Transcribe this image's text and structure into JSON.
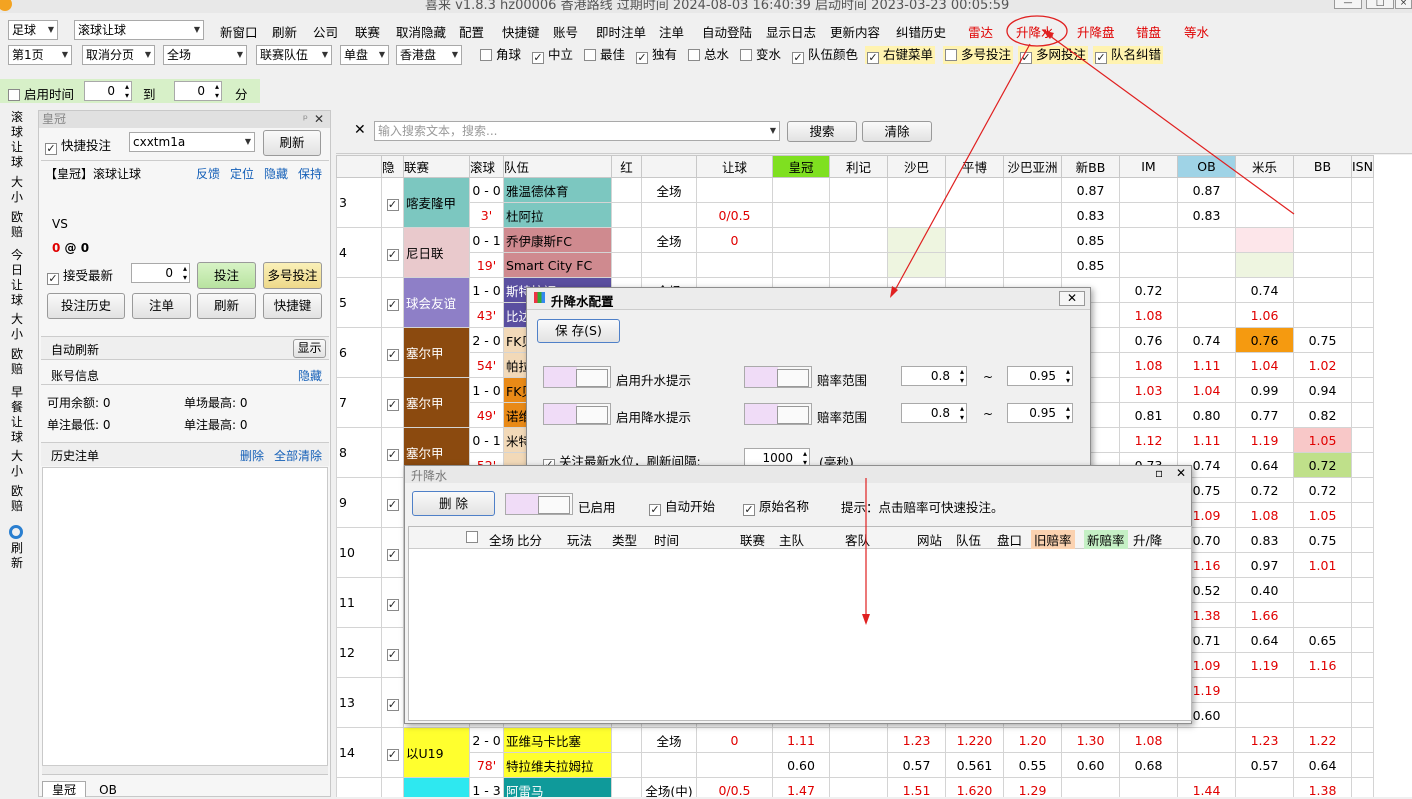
{
  "window": {
    "title": "喜来 v1.8.3 hz00006 香港路线 过期时间 2024-08-03 16:40:39 启动时间 2023-03-23 00:05:59"
  },
  "toolbar": {
    "sport": "足球",
    "mode": "滚球让球",
    "menus": [
      "新窗口",
      "刷新",
      "公司",
      "联赛",
      "取消隐藏",
      "配置",
      "快捷键",
      "账号",
      "即时注单",
      "注单",
      "自动登陆",
      "显示日志",
      "更新内容",
      "纠错历史"
    ],
    "red_menus": [
      "雷达",
      "升降水",
      "升降盘",
      "错盘",
      "等水"
    ]
  },
  "toolbar2": {
    "page": "第1页",
    "paging": "取消分页",
    "scope": "全场",
    "team_filter": "联赛队伍",
    "bet_type": "单盘",
    "odds_type": "香港盘",
    "checks": [
      {
        "label": "角球",
        "checked": false
      },
      {
        "label": "中立",
        "checked": true
      },
      {
        "label": "最佳",
        "checked": false
      },
      {
        "label": "独有",
        "checked": true
      },
      {
        "label": "总水",
        "checked": false
      },
      {
        "label": "变水",
        "checked": false
      },
      {
        "label": "队伍颜色",
        "checked": true
      },
      {
        "label": "右键菜单",
        "checked": true
      },
      {
        "label": "多号投注",
        "checked": false
      },
      {
        "label": "多网投注",
        "checked": true
      },
      {
        "label": "队名纠错",
        "checked": true
      }
    ]
  },
  "timer": {
    "label": "启用时间",
    "from": "0",
    "to_label": "到",
    "to": "0",
    "unit": "分"
  },
  "side_tabs": [
    "滚球让球",
    "大小",
    "欧赔",
    "今日让球",
    "大小",
    "欧赔",
    "早餐让球",
    "大小",
    "欧赔",
    "刷新"
  ],
  "left_panel": {
    "title": "皇冠",
    "quick_bet": "快捷投注",
    "account": "cxxtm1a",
    "refresh": "刷新",
    "game_title": "【皇冠】滚球让球",
    "links": [
      "反馈",
      "定位",
      "隐藏",
      "保持"
    ],
    "vs": "VS",
    "score_a": "0",
    "at": "@",
    "score_b": "0",
    "accept": "接受最新",
    "amount": "0",
    "bet": "投注",
    "multi_bet": "多号投注",
    "history": "投注历史",
    "orders": "注单",
    "refresh2": "刷新",
    "hotkey": "快捷键",
    "auto_refresh": "自动刷新",
    "show": "显示",
    "acct_info": "账号信息",
    "hide": "隐藏",
    "balance_label": "可用余额: 0",
    "max_match": "单场最高: 0",
    "min_bet": "单注最低: 0",
    "max_bet": "单注最高: 0",
    "history_title": "历史注单",
    "delete": "删除",
    "clear_all": "全部清除",
    "bottom_tabs": [
      "皇冠",
      "OB"
    ]
  },
  "search": {
    "placeholder": "输入搜索文本，搜索...",
    "search": "搜索",
    "clear": "清除"
  },
  "grid": {
    "headers": [
      "隐",
      "联赛",
      "滚球",
      "队伍",
      "红",
      "",
      "让球",
      "皇冠",
      "利记",
      "沙巴",
      "平博",
      "沙巴亚洲",
      "新BB",
      "IM",
      "OB",
      "米乐",
      "BB",
      "ISN"
    ],
    "rows": [
      {
        "no": "3",
        "league": "喀麦隆甲",
        "lcolor": "#7cc7c0",
        "score": "0 - 0",
        "time": "3'",
        "home": "雅温德体育",
        "away": "杜阿拉",
        "hcolor": "#7cc7c0",
        "scope": "全场",
        "hdp": [
          "",
          "0/0.5"
        ],
        "hg": [
          "",
          ""
        ],
        "lj": [
          "",
          ""
        ],
        "sb": [
          "",
          ""
        ],
        "pb": [
          "",
          ""
        ],
        "sba": [
          "",
          ""
        ],
        "nbb": [
          "0.87",
          "0.83"
        ],
        "im": [
          "",
          ""
        ],
        "ob": [
          "0.87",
          "0.83"
        ],
        "ml": [
          "",
          ""
        ],
        "bb": [
          "",
          ""
        ],
        "isn": [
          "",
          ""
        ]
      },
      {
        "no": "4",
        "league": "尼日联",
        "lcolor": "#e9c9cc",
        "score": "0 - 1",
        "time": "19'",
        "home": "乔伊康斯FC",
        "away": "Smart City FC",
        "hcolor": "#cf8a8f",
        "scope": "全场",
        "hdp": [
          "0",
          ""
        ],
        "hg": [
          "",
          ""
        ],
        "lj": [
          "",
          ""
        ],
        "sb": [
          "",
          ""
        ],
        "pb": [
          "",
          ""
        ],
        "sba": [
          "",
          ""
        ],
        "nbb": [
          "0.85",
          "0.85"
        ],
        "im": [
          "",
          ""
        ],
        "ob": [
          "",
          ""
        ],
        "ml": [
          "",
          ""
        ],
        "bb": [
          "",
          ""
        ],
        "isn": [
          "",
          ""
        ]
      },
      {
        "no": "5",
        "league": "球会友谊",
        "lcolor": "#8e7fc7",
        "score": "1 - 0",
        "time": "43'",
        "home": "斯特拉福",
        "away": "比达",
        "hcolor": "#5a4fa0",
        "scope": "全场",
        "hdp": [
          "",
          ""
        ],
        "hg": [
          "",
          ""
        ],
        "lj": [
          "",
          ""
        ],
        "sb": [
          "",
          ""
        ],
        "pb": [
          "",
          ""
        ],
        "sba": [
          "",
          ""
        ],
        "nbb": [
          "",
          ""
        ],
        "im": [
          "0.72",
          "1.08"
        ],
        "ob": [
          "",
          ""
        ],
        "ml": [
          "0.74",
          "1.06"
        ],
        "bb": [
          "",
          ""
        ],
        "isn": [
          "",
          ""
        ]
      },
      {
        "no": "6",
        "league": "塞尔甲",
        "lcolor": "#8b4a0f",
        "score": "2 - 0",
        "time": "54'",
        "home": "FK贝",
        "away": "帕拉",
        "hcolor": "#f2d9b8",
        "scope": "",
        "hdp": [
          "",
          ""
        ],
        "hg": [
          "",
          ""
        ],
        "lj": [
          "",
          ""
        ],
        "sb": [
          "",
          ""
        ],
        "pb": [
          "",
          ""
        ],
        "sba": [
          "",
          ""
        ],
        "nbb": [
          "",
          ""
        ],
        "im": [
          "0.76",
          "1.08"
        ],
        "ob": [
          "0.74",
          "1.11"
        ],
        "ml": [
          "0.76",
          "1.04"
        ],
        "bb": [
          "0.75",
          "1.02"
        ],
        "isn": [
          "",
          ""
        ]
      },
      {
        "no": "7",
        "league": "塞尔甲",
        "lcolor": "#8b4a0f",
        "score": "1 - 0",
        "time": "49'",
        "home": "FK贝",
        "away": "诺维",
        "hcolor": "#e98a17",
        "scope": "",
        "hdp": [
          "",
          ""
        ],
        "hg": [
          "",
          ""
        ],
        "lj": [
          "",
          ""
        ],
        "sb": [
          "",
          ""
        ],
        "pb": [
          "",
          ""
        ],
        "sba": [
          "",
          ""
        ],
        "nbb": [
          "",
          ""
        ],
        "im": [
          "1.03",
          "0.81"
        ],
        "ob": [
          "1.04",
          "0.80"
        ],
        "ml": [
          "0.99",
          "0.77"
        ],
        "bb": [
          "0.94",
          "0.82"
        ],
        "isn": [
          "",
          ""
        ]
      },
      {
        "no": "8",
        "league": "塞尔甲",
        "lcolor": "#8b4a0f",
        "score": "0 - 1",
        "time": "52'",
        "home": "米特",
        "away": "",
        "hcolor": "#f2d9b8",
        "scope": "",
        "hdp": [
          "",
          ""
        ],
        "hg": [
          "",
          ""
        ],
        "lj": [
          "",
          ""
        ],
        "sb": [
          "",
          ""
        ],
        "pb": [
          "",
          ""
        ],
        "sba": [
          "",
          ""
        ],
        "nbb": [
          "",
          ""
        ],
        "im": [
          "1.12",
          "0.73"
        ],
        "ob": [
          "1.11",
          "0.74"
        ],
        "ml": [
          "1.19",
          "0.64"
        ],
        "bb": [
          "1.05",
          "0.72"
        ],
        "isn": [
          "",
          ""
        ]
      },
      {
        "no": "9",
        "league": "",
        "lcolor": "#ffffff",
        "score": "",
        "time": "",
        "home": "",
        "away": "",
        "hcolor": "#ffffff",
        "scope": "",
        "hdp": [
          "",
          ""
        ],
        "hg": [
          "",
          ""
        ],
        "lj": [
          "",
          ""
        ],
        "sb": [
          "",
          ""
        ],
        "pb": [
          "",
          ""
        ],
        "sba": [
          "",
          ""
        ],
        "nbb": [
          "",
          ""
        ],
        "im": [
          "",
          ""
        ],
        "ob": [
          "0.75",
          "1.09"
        ],
        "ml": [
          "0.72",
          "1.08"
        ],
        "bb": [
          "0.72",
          "1.05"
        ],
        "isn": [
          "",
          ""
        ]
      },
      {
        "no": "10",
        "league": "",
        "lcolor": "#ffffff",
        "score": "",
        "time": "",
        "home": "",
        "away": "",
        "hcolor": "#ffffff",
        "scope": "",
        "hdp": [
          "",
          ""
        ],
        "hg": [
          "",
          ""
        ],
        "lj": [
          "",
          ""
        ],
        "sb": [
          "",
          ""
        ],
        "pb": [
          "",
          ""
        ],
        "sba": [
          "",
          ""
        ],
        "nbb": [
          "",
          ""
        ],
        "im": [
          "",
          ""
        ],
        "ob": [
          "0.70",
          "1.16"
        ],
        "ml": [
          "0.83",
          "0.97"
        ],
        "bb": [
          "0.75",
          "1.01"
        ],
        "isn": [
          "",
          ""
        ]
      },
      {
        "no": "11",
        "league": "",
        "lcolor": "#ffffff",
        "score": "",
        "time": "",
        "home": "",
        "away": "",
        "hcolor": "#ffffff",
        "scope": "",
        "hdp": [
          "",
          ""
        ],
        "hg": [
          "",
          ""
        ],
        "lj": [
          "",
          ""
        ],
        "sb": [
          "",
          ""
        ],
        "pb": [
          "",
          ""
        ],
        "sba": [
          "",
          ""
        ],
        "nbb": [
          "",
          ""
        ],
        "im": [
          "",
          ""
        ],
        "ob": [
          "0.52",
          "1.38"
        ],
        "ml": [
          "0.40",
          "1.66"
        ],
        "bb": [
          "",
          ""
        ],
        "isn": [
          "",
          ""
        ]
      },
      {
        "no": "12",
        "league": "",
        "lcolor": "#ffffff",
        "score": "",
        "time": "",
        "home": "",
        "away": "",
        "hcolor": "#ffffff",
        "scope": "",
        "hdp": [
          "",
          ""
        ],
        "hg": [
          "",
          ""
        ],
        "lj": [
          "",
          ""
        ],
        "sb": [
          "",
          ""
        ],
        "pb": [
          "",
          ""
        ],
        "sba": [
          "",
          ""
        ],
        "nbb": [
          "",
          ""
        ],
        "im": [
          "",
          ""
        ],
        "ob": [
          "0.71",
          "1.09"
        ],
        "ml": [
          "0.64",
          "1.19"
        ],
        "bb": [
          "0.65",
          "1.16"
        ],
        "isn": [
          "",
          ""
        ]
      },
      {
        "no": "13",
        "league": "",
        "lcolor": "#ffffff",
        "score": "",
        "time": "",
        "home": "",
        "away": "",
        "hcolor": "#ffffff",
        "scope": "",
        "hdp": [
          "",
          ""
        ],
        "hg": [
          "",
          ""
        ],
        "lj": [
          "",
          ""
        ],
        "sb": [
          "",
          ""
        ],
        "pb": [
          "",
          ""
        ],
        "sba": [
          "",
          ""
        ],
        "nbb": [
          "",
          ""
        ],
        "im": [
          "",
          ""
        ],
        "ob": [
          "1.19",
          "0.60"
        ],
        "ml": [
          "",
          ""
        ],
        "bb": [
          "",
          ""
        ],
        "isn": [
          "",
          ""
        ]
      },
      {
        "no": "14",
        "league": "以U19",
        "lcolor": "#ffff2e",
        "score": "2 - 0",
        "time": "78'",
        "home": "亚维马卡比塞",
        "away": "特拉维夫拉姆拉",
        "hcolor": "#ffff2e",
        "scope": "全场",
        "hdp": [
          "0",
          ""
        ],
        "hg": [
          "1.11",
          "0.60"
        ],
        "lj": [
          "",
          ""
        ],
        "sb": [
          "1.23",
          "0.57"
        ],
        "pb": [
          "1.220",
          "0.561"
        ],
        "sba": [
          "1.20",
          "0.55"
        ],
        "nbb": [
          "1.30",
          "0.60"
        ],
        "im": [
          "1.08",
          "0.68"
        ],
        "ob": [
          "",
          ""
        ],
        "ml": [
          "1.23",
          "0.57"
        ],
        "bb": [
          "1.22",
          "0.64"
        ],
        "isn": [
          "",
          ""
        ]
      },
      {
        "no": "",
        "league": "",
        "lcolor": "#2ee8f0",
        "score": "1 - 3",
        "time": "",
        "home": "阿雷马",
        "away": "",
        "hcolor": "#0f9a9a",
        "scope": "全场(中)",
        "hdp": [
          "0/0.5",
          ""
        ],
        "hg": [
          "1.47",
          ""
        ],
        "lj": [
          "",
          ""
        ],
        "sb": [
          "1.51",
          ""
        ],
        "pb": [
          "1.620",
          ""
        ],
        "sba": [
          "1.29",
          ""
        ],
        "nbb": [
          "",
          ""
        ],
        "im": [
          "",
          ""
        ],
        "ob": [
          "1.44",
          ""
        ],
        "ml": [
          "",
          ""
        ],
        "bb": [
          "1.38",
          ""
        ],
        "isn": [
          "",
          ""
        ]
      }
    ]
  },
  "config_dialog": {
    "title": "升降水配置",
    "save": "保 存(S)",
    "rise_label": "启用升水提示",
    "fall_label": "启用降水提示",
    "range_label": "赔率范围",
    "rise_min": "0.8",
    "rise_max": "0.95",
    "fall_min": "0.8",
    "fall_max": "0.95",
    "tilde": "~",
    "watch_label": "关注最新水位，刷新间隔:",
    "interval": "1000",
    "unit": "(毫秒)"
  },
  "water_dialog": {
    "title": "升降水",
    "delete": "删 除",
    "enabled": "已启用",
    "auto_start": "自动开始",
    "orig_name": "原始名称",
    "hint": "提示：点击赔率可快速投注。",
    "columns": [
      "全场",
      "比分",
      "玩法",
      "类型",
      "时间",
      "联赛",
      "主队",
      "客队",
      "网站",
      "队伍",
      "盘口",
      "旧赔率",
      "新赔率",
      "升/降"
    ]
  }
}
